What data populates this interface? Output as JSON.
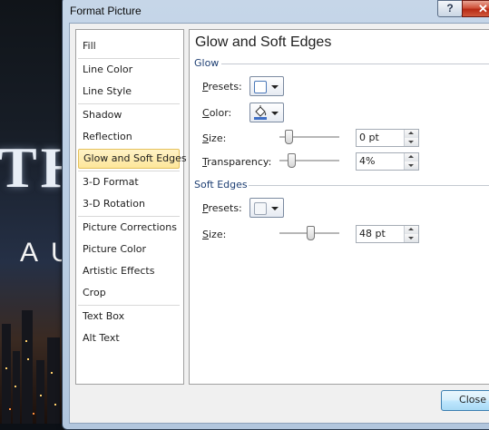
{
  "window": {
    "title": "Format Picture"
  },
  "titlebar": {
    "help_label": "?",
    "close_glyph": "✕"
  },
  "nav": {
    "items": [
      {
        "label": "Fill"
      },
      {
        "label": "Line Color"
      },
      {
        "label": "Line Style"
      },
      {
        "label": "Shadow"
      },
      {
        "label": "Reflection"
      },
      {
        "label": "Glow and Soft Edges",
        "selected": true
      },
      {
        "label": "3-D Format"
      },
      {
        "label": "3-D Rotation"
      },
      {
        "label": "Picture Corrections"
      },
      {
        "label": "Picture Color"
      },
      {
        "label": "Artistic Effects"
      },
      {
        "label": "Crop"
      },
      {
        "label": "Text Box"
      },
      {
        "label": "Alt Text"
      }
    ]
  },
  "panel": {
    "title": "Glow and Soft Edges",
    "glow": {
      "section_label": "Glow",
      "presets_label_u": "P",
      "presets_label_rest": "resets:",
      "color_label_u": "C",
      "color_label_rest": "olor:",
      "size_label_u": "S",
      "size_label_rest": "ize:",
      "size_value": "0 pt",
      "transparency_label_u": "T",
      "transparency_label_rest": "ransparency:",
      "transparency_value": "4%",
      "size_level": 0,
      "transparency_level": 0.04,
      "color_swatch": "#3f6fc6"
    },
    "soft_edges": {
      "section_label": "Soft Edges",
      "presets_label_u": "P",
      "presets_label_rest": "resets:",
      "size_label_u": "S",
      "size_label_rest": "ize:",
      "size_value": "48 pt"
    }
  },
  "footer": {
    "close_label": "Close"
  },
  "background": {
    "letters": "TH",
    "sub": "AU"
  }
}
